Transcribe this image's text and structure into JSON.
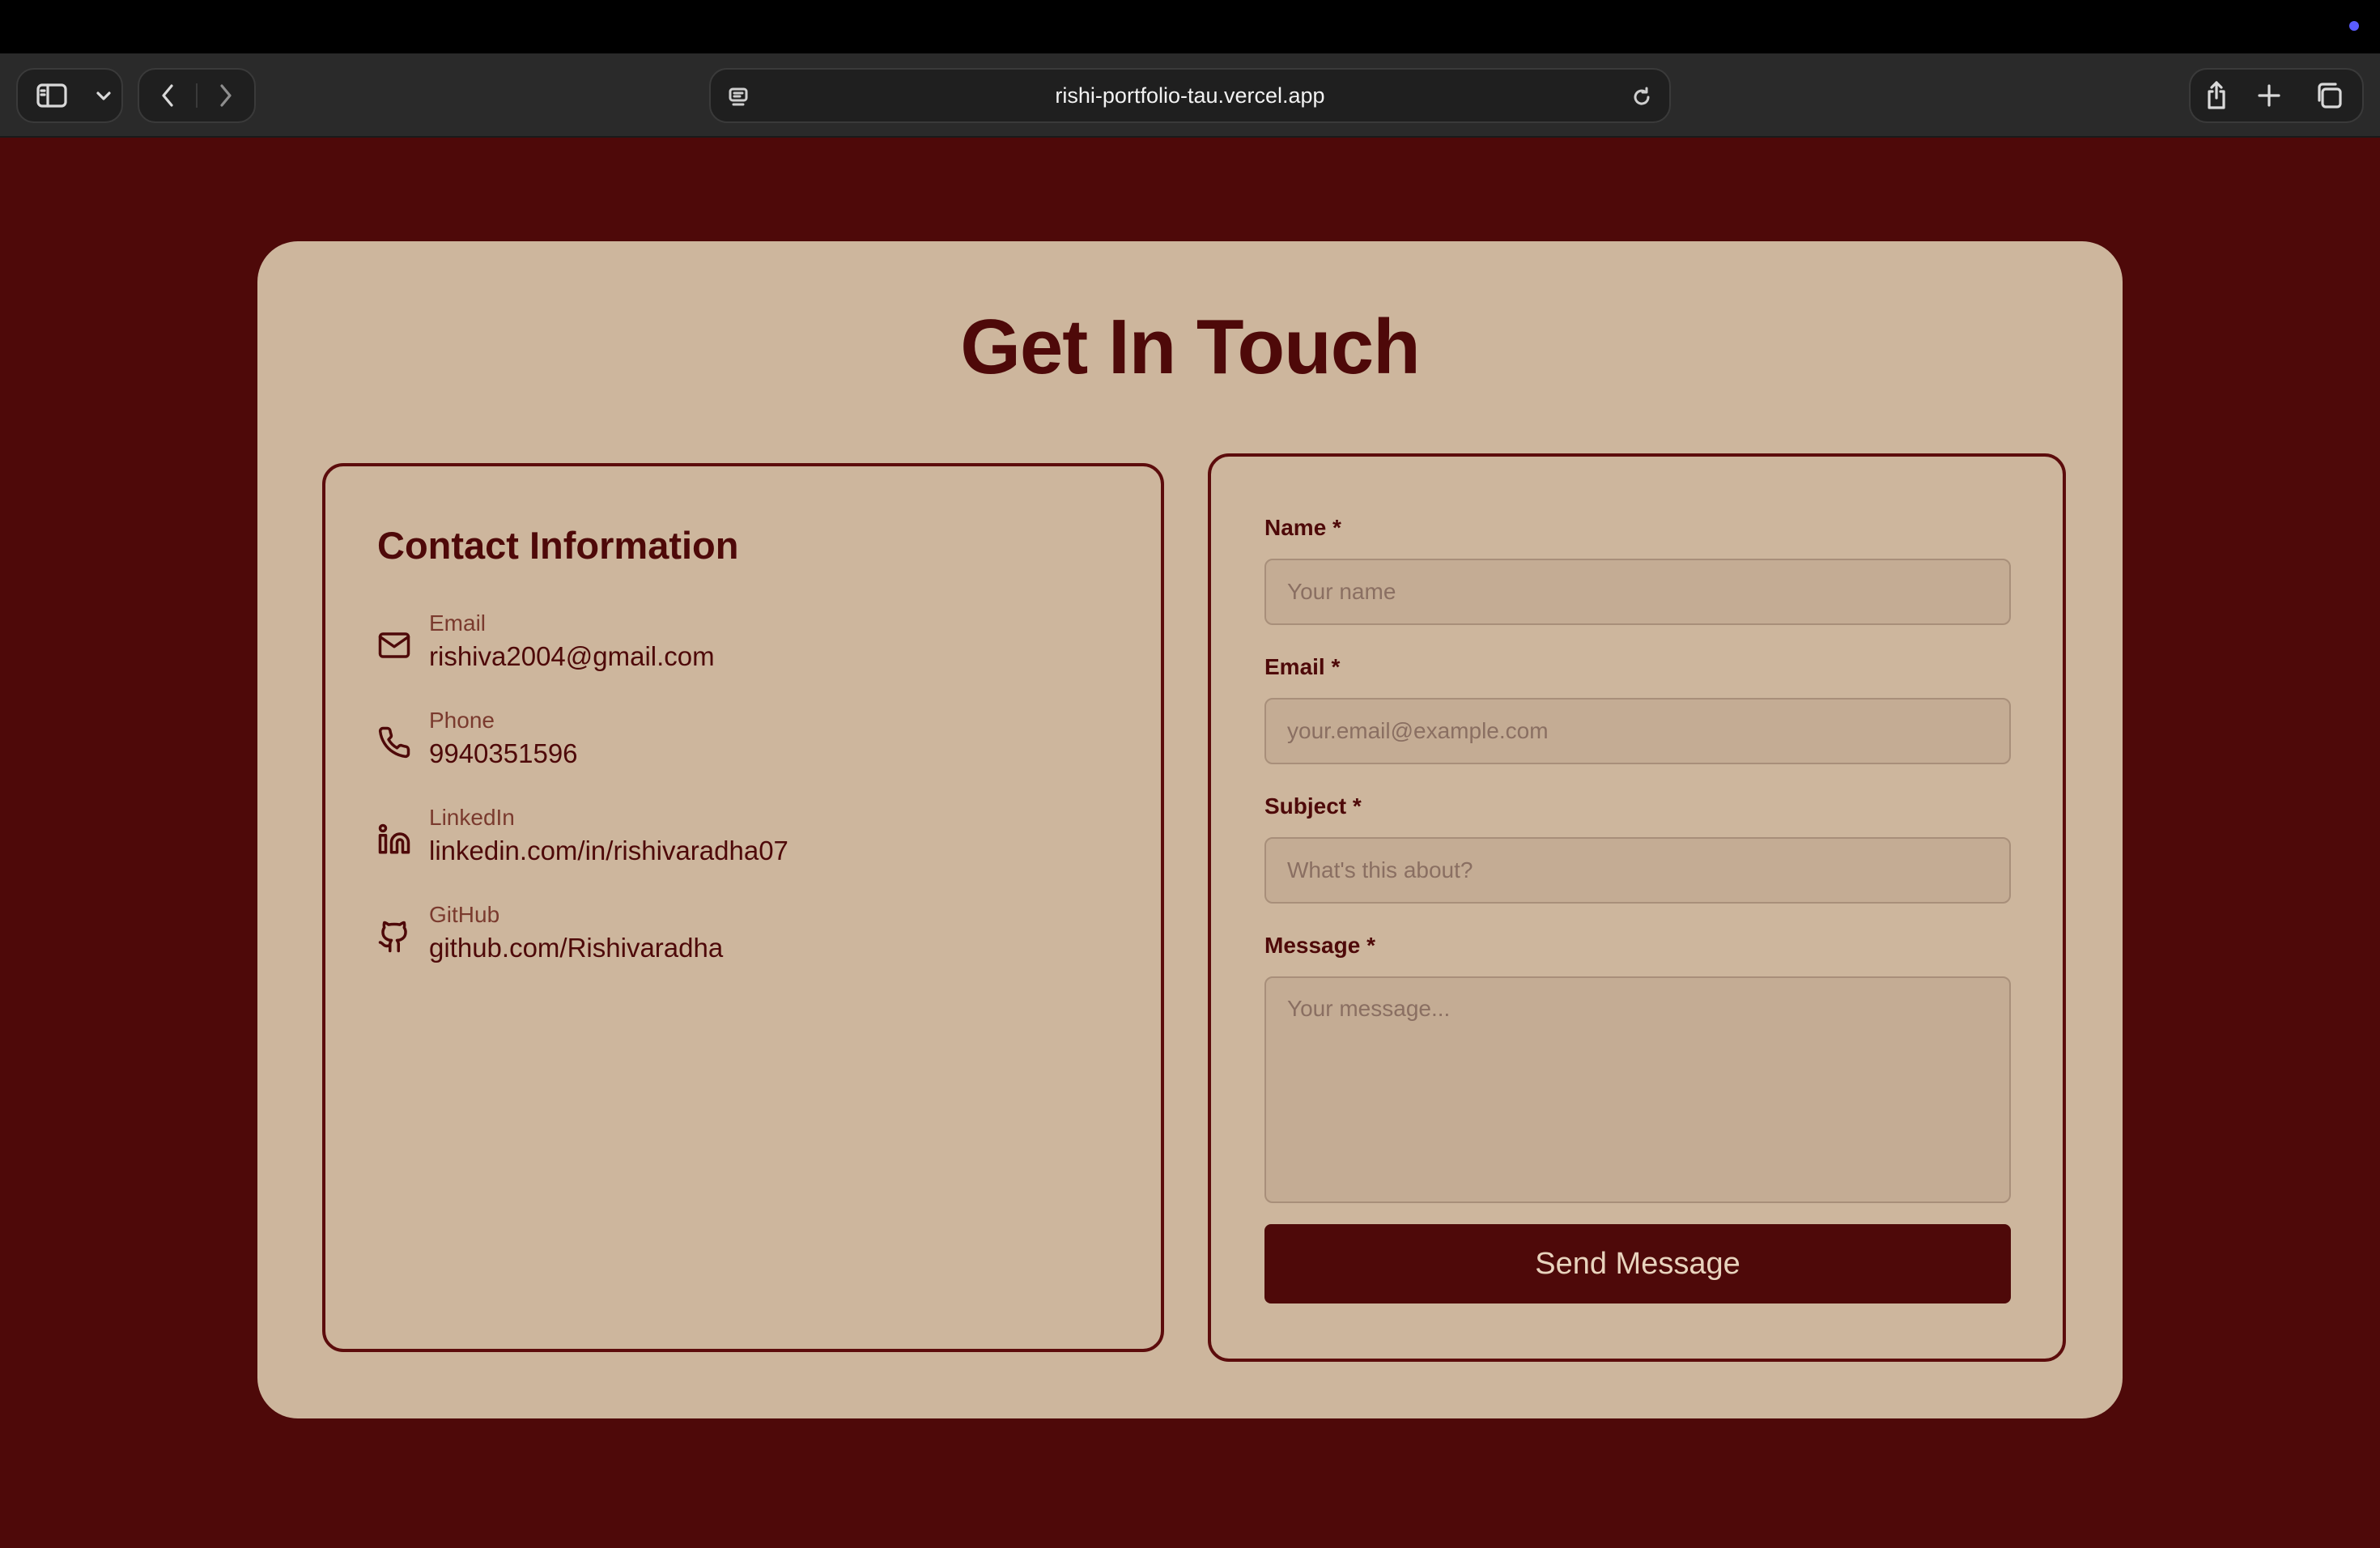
{
  "browser": {
    "url": "rishi-portfolio-tau.vercel.app"
  },
  "page": {
    "title": "Get In Touch"
  },
  "contact": {
    "title": "Contact Information",
    "items": [
      {
        "label": "Email",
        "value": "rishiva2004@gmail.com",
        "icon": "mail-icon"
      },
      {
        "label": "Phone",
        "value": "9940351596",
        "icon": "phone-icon"
      },
      {
        "label": "LinkedIn",
        "value": "linkedin.com/in/rishivaradha07",
        "icon": "linkedin-icon"
      },
      {
        "label": "GitHub",
        "value": "github.com/Rishivaradha",
        "icon": "github-icon"
      }
    ]
  },
  "form": {
    "name_label": "Name *",
    "name_placeholder": "Your name",
    "email_label": "Email *",
    "email_placeholder": "your.email@example.com",
    "subject_label": "Subject *",
    "subject_placeholder": "What's this about?",
    "message_label": "Message *",
    "message_placeholder": "Your message...",
    "submit_label": "Send Message"
  },
  "colors": {
    "background": "#4e0909",
    "card": "#cdb69d",
    "accent": "#4e0909"
  }
}
